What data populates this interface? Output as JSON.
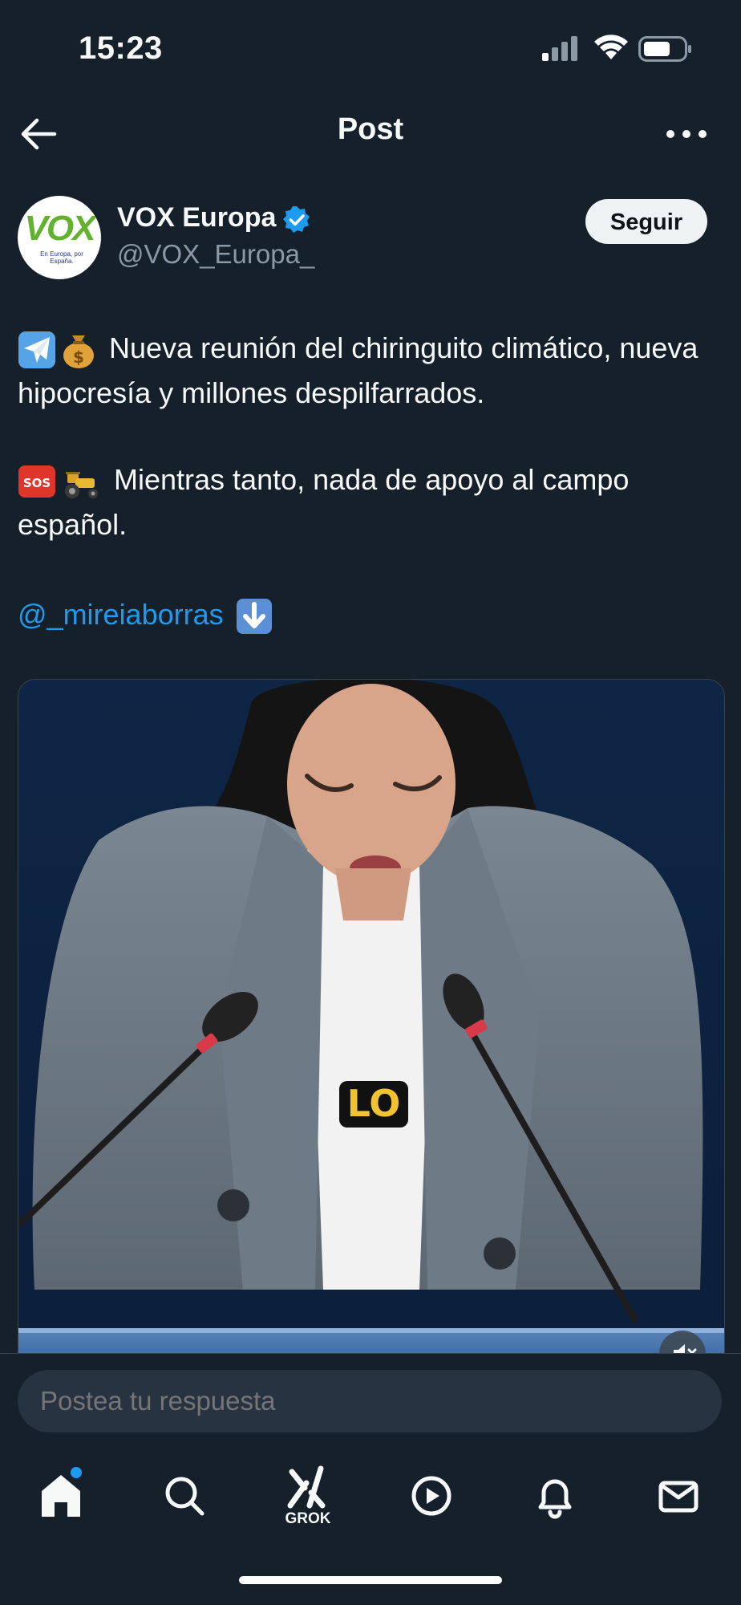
{
  "status_bar": {
    "time": "15:23"
  },
  "header": {
    "title": "Post"
  },
  "author": {
    "logo_text": "VOX",
    "logo_tagline": "En Europa, por España.",
    "name": "VOX Europa",
    "handle": "@VOX_Europa_",
    "follow_label": "Seguir"
  },
  "tweet": {
    "line1": "Nueva reunión del chiringuito climático, nueva hipocresía y millones despilfarrados.",
    "line2": "Mientras tanto, nada de apoyo al campo español.",
    "mention": "@_mireiaborras"
  },
  "media": {
    "caption": "LO"
  },
  "reply": {
    "placeholder": "Postea tu respuesta"
  },
  "tab_bar": {
    "grok_label": "GROK"
  },
  "colors": {
    "background": "#15202b",
    "accent": "#1d9bf0",
    "muted": "#8b98a5"
  }
}
